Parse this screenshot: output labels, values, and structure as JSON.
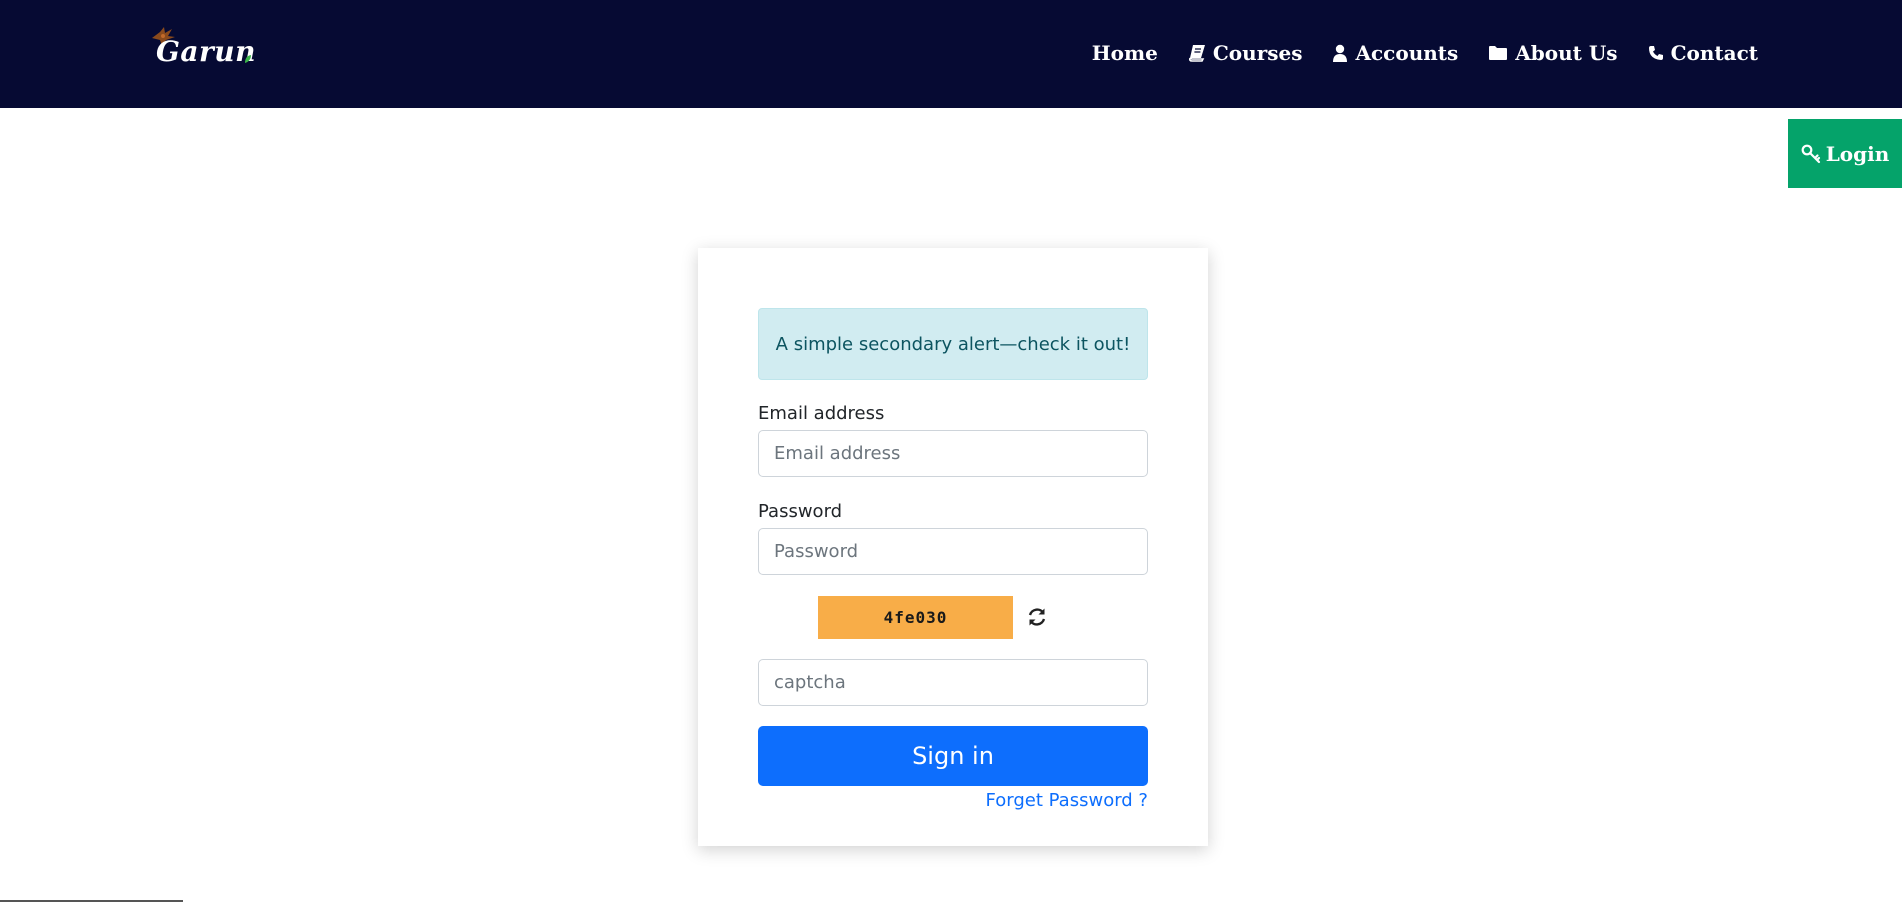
{
  "brand": {
    "name": "Garun"
  },
  "nav": {
    "items": [
      {
        "label": "Home",
        "icon": ""
      },
      {
        "label": "Courses",
        "icon": "book-icon"
      },
      {
        "label": "Accounts",
        "icon": "user-icon"
      },
      {
        "label": "About Us",
        "icon": "folder-icon"
      },
      {
        "label": "Contact",
        "icon": "phone-icon"
      }
    ]
  },
  "login_tab": {
    "label": "Login",
    "icon": "key-icon"
  },
  "login_form": {
    "alert_text": "A simple secondary alert—check it out!",
    "email_label": "Email address",
    "email_placeholder": "Email address",
    "password_label": "Password",
    "password_placeholder": "Password",
    "captcha_code": "4fe030",
    "captcha_placeholder": "captcha",
    "signin_label": "Sign in",
    "forget_label": "Forget Password ?"
  },
  "colors": {
    "nav_bg": "#060a33",
    "login_tab_bg": "#05a36a",
    "alert_bg": "#d1ecf1",
    "captcha_bg": "#f8ad48",
    "primary": "#0d6efd"
  }
}
